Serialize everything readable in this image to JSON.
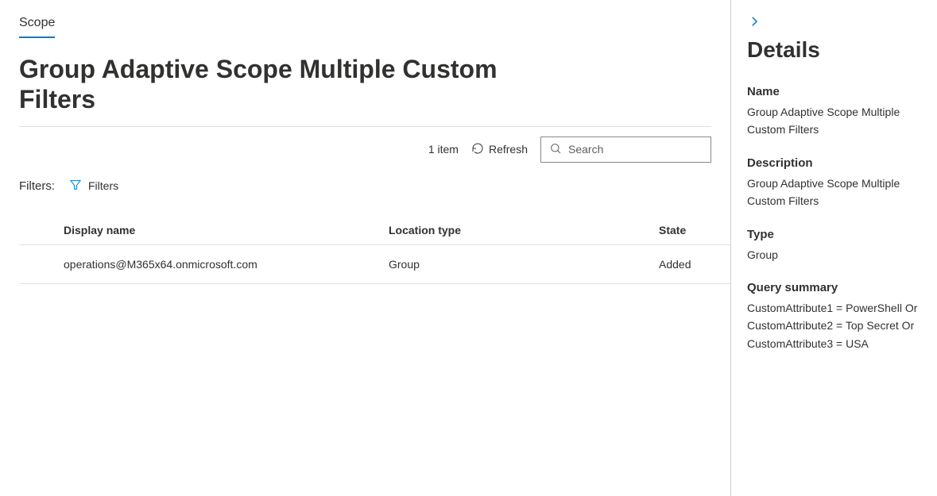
{
  "tab": {
    "label": "Scope"
  },
  "page_title": "Group Adaptive Scope Multiple Custom Filters",
  "toolbar": {
    "item_count": "1 item",
    "refresh_label": "Refresh",
    "search_placeholder": "Search"
  },
  "filters": {
    "label": "Filters:",
    "chip_label": "Filters"
  },
  "table": {
    "headers": {
      "display_name": "Display name",
      "location_type": "Location type",
      "state": "State"
    },
    "rows": [
      {
        "display_name": "operations@M365x64.onmicrosoft.com",
        "location_type": "Group",
        "state": "Added"
      }
    ]
  },
  "details": {
    "title": "Details",
    "fields": {
      "name": {
        "label": "Name",
        "value": "Group Adaptive Scope Multiple Custom Filters"
      },
      "description": {
        "label": "Description",
        "value": "Group Adaptive Scope Multiple Custom Filters"
      },
      "type": {
        "label": "Type",
        "value": "Group"
      },
      "query_summary": {
        "label": "Query summary",
        "value": "CustomAttribute1 = PowerShell Or CustomAttribute2 = Top Secret Or CustomAttribute3 = USA"
      }
    }
  }
}
